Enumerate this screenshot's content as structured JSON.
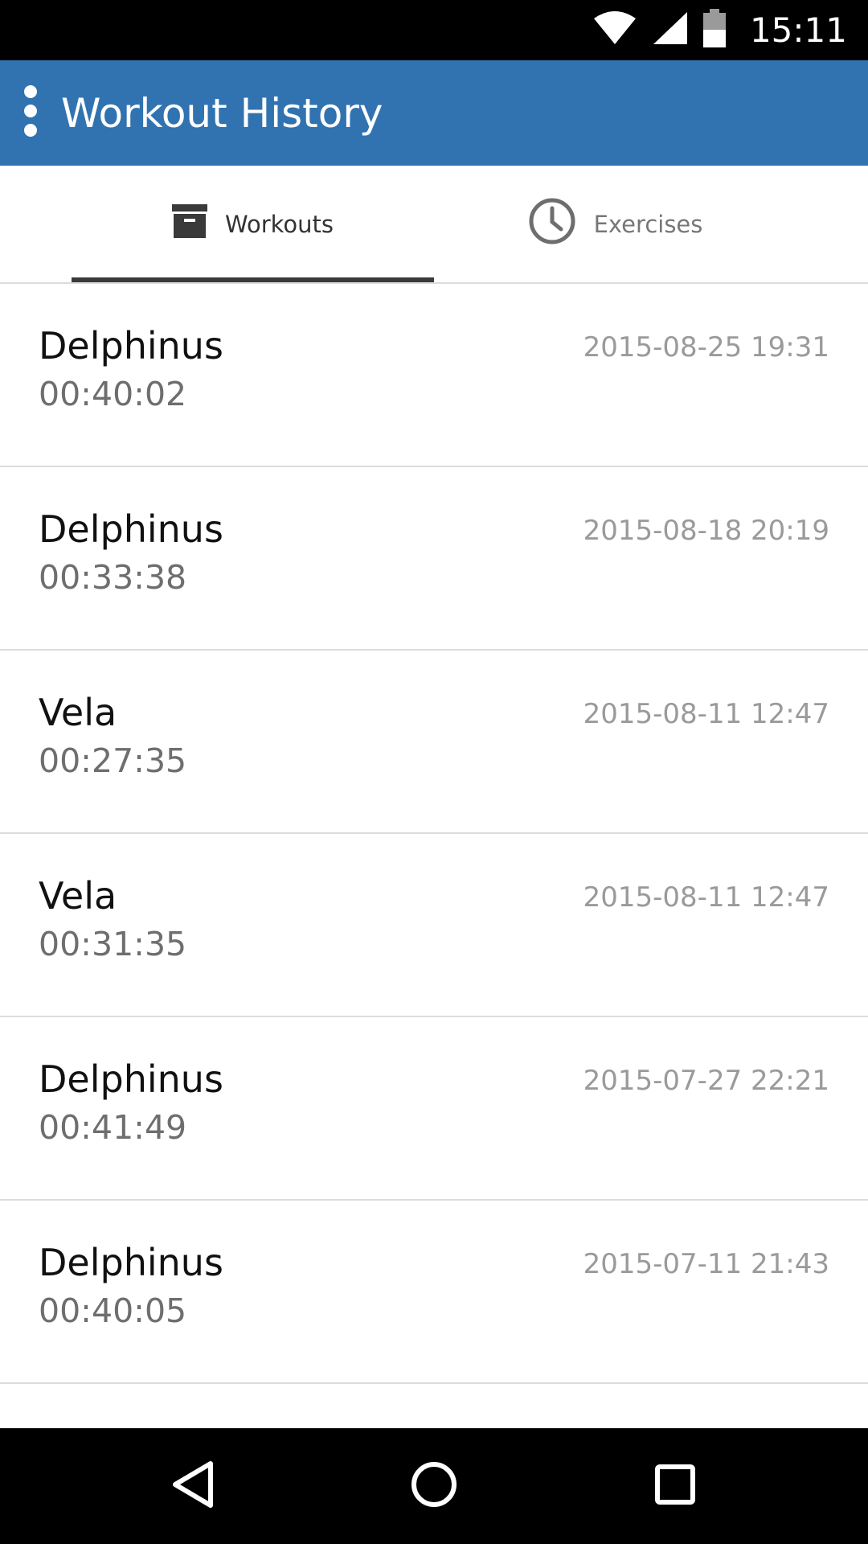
{
  "status_bar": {
    "time": "15:11",
    "icons": [
      "wifi-icon",
      "signal-icon",
      "battery-icon"
    ]
  },
  "app_bar": {
    "title": "Workout History",
    "menu_icon": "more-vert-icon",
    "color": "#3173b0"
  },
  "tabs": [
    {
      "label": "Workouts",
      "icon": "archive-box-icon",
      "selected": true
    },
    {
      "label": "Exercises",
      "icon": "clock-icon",
      "selected": false
    }
  ],
  "workouts": [
    {
      "name": "Delphinus",
      "duration": "00:40:02",
      "date": "2015-08-25 19:31"
    },
    {
      "name": "Delphinus",
      "duration": "00:33:38",
      "date": "2015-08-18 20:19"
    },
    {
      "name": "Vela",
      "duration": "00:27:35",
      "date": "2015-08-11 12:47"
    },
    {
      "name": "Vela",
      "duration": "00:31:35",
      "date": "2015-08-11 12:47"
    },
    {
      "name": "Delphinus",
      "duration": "00:41:49",
      "date": "2015-07-27 22:21"
    },
    {
      "name": "Delphinus",
      "duration": "00:40:05",
      "date": "2015-07-11 21:43"
    }
  ],
  "nav_bar": {
    "icons": [
      "back-icon",
      "home-icon",
      "recents-icon"
    ]
  }
}
